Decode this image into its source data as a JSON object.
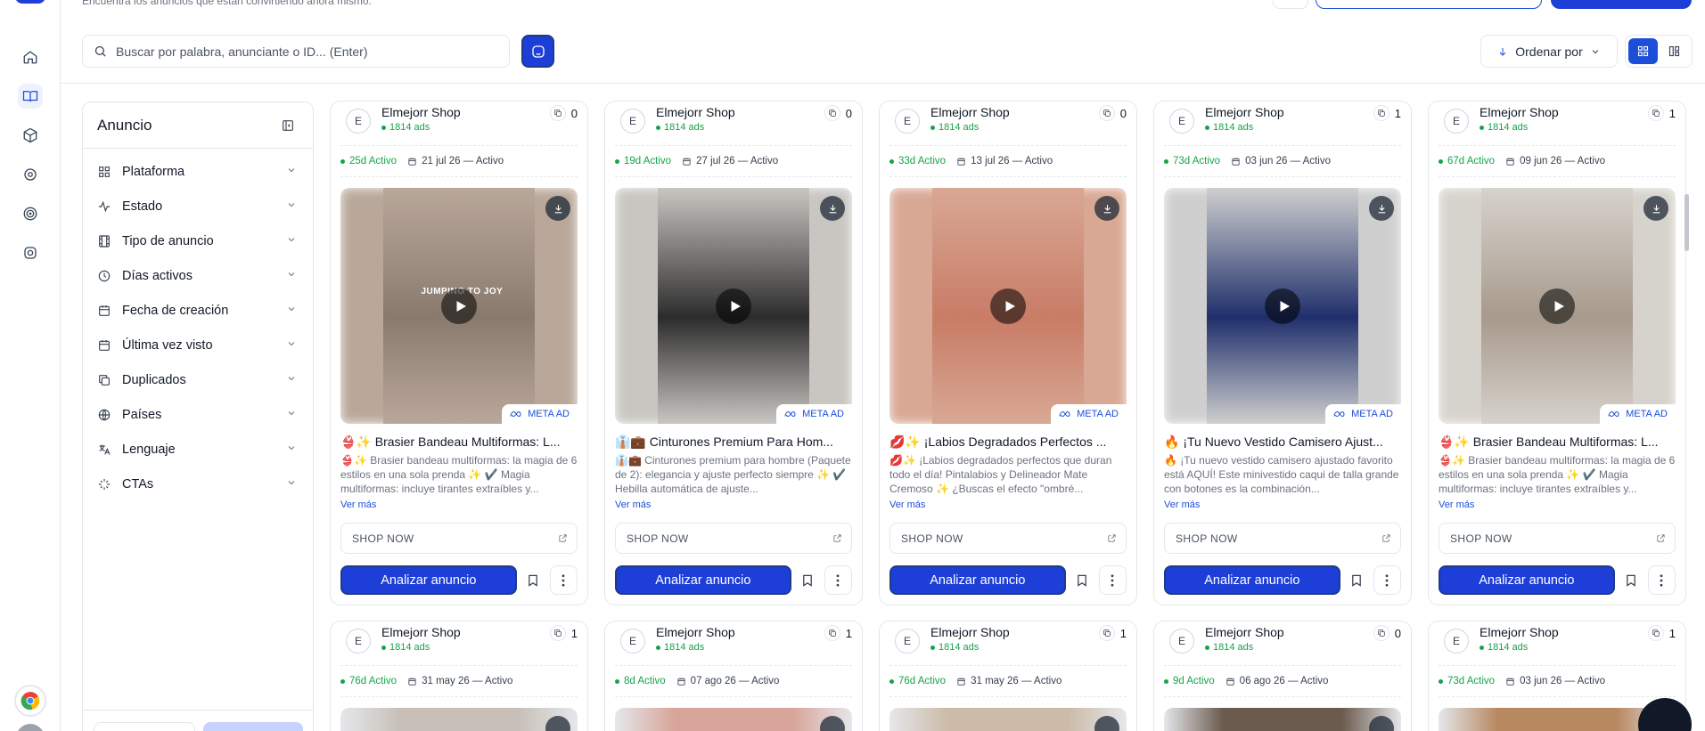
{
  "header": {
    "subtitle": "Encuentra los anuncios que están convirtiendo ahora mismo."
  },
  "search": {
    "placeholder": "Buscar por palabra, anunciante o ID... (Enter)"
  },
  "toolbar": {
    "sort_label": "Ordenar por"
  },
  "filters": {
    "title": "Anuncio",
    "items": [
      {
        "label": "Plataforma",
        "icon": "grid-icon"
      },
      {
        "label": "Estado",
        "icon": "activity-icon"
      },
      {
        "label": "Tipo de anuncio",
        "icon": "film-icon"
      },
      {
        "label": "Días activos",
        "icon": "clock-icon"
      },
      {
        "label": "Fecha de creación",
        "icon": "calendar-icon"
      },
      {
        "label": "Última vez visto",
        "icon": "calendar-icon"
      },
      {
        "label": "Duplicados",
        "icon": "copy-icon"
      },
      {
        "label": "Países",
        "icon": "globe-icon"
      },
      {
        "label": "Lenguaje",
        "icon": "language-icon"
      },
      {
        "label": "CTAs",
        "icon": "sparkle-icon"
      }
    ]
  },
  "cards": [
    {
      "advertiser": "Elmejorr Shop",
      "initial": "E",
      "ads_count": "1814 ads",
      "duplicates": "0",
      "days_active": "25d Activo",
      "date": "21 jul 26 — Activo",
      "badge": "META AD",
      "overlay": "JUMPING TO JOY",
      "title": "👙✨ Brasier Bandeau Multiformas: L...",
      "description": "👙✨ Brasier bandeau multiformas: la magia de 6 estilos en una sola prenda ✨ ✔️ Magia multiformas: incluye tirantes extraíbles y...",
      "more": "Ver más",
      "cta": "SHOP NOW",
      "analyze": "Analizar anuncio",
      "colors": {
        "bg": "#b9a89a",
        "center": "#8a7a6e"
      }
    },
    {
      "advertiser": "Elmejorr Shop",
      "initial": "E",
      "ads_count": "1814 ads",
      "duplicates": "0",
      "days_active": "19d Activo",
      "date": "27 jul 26 — Activo",
      "badge": "META AD",
      "overlay": "",
      "title": "👔💼 Cinturones Premium Para Hom...",
      "description": "👔💼 Cinturones premium para hombre (Paquete de 2): elegancia y ajuste perfecto siempre ✨ ✔️ Hebilla automática de ajuste...",
      "more": "Ver más",
      "cta": "SHOP NOW",
      "analyze": "Analizar anuncio",
      "colors": {
        "bg": "#c9c6c2",
        "center": "#2c2c2c"
      }
    },
    {
      "advertiser": "Elmejorr Shop",
      "initial": "E",
      "ads_count": "1814 ads",
      "duplicates": "0",
      "days_active": "33d Activo",
      "date": "13 jul 26 — Activo",
      "badge": "META AD",
      "overlay": "",
      "title": "💋✨ ¡Labios Degradados Perfectos ...",
      "description": "💋✨ ¡Labios degradados perfectos que duran todo el día! Pintalabios y Delineador Mate Cremoso ✨ ¿Buscas el efecto \"ombré...",
      "more": "Ver más",
      "cta": "SHOP NOW",
      "analyze": "Analizar anuncio",
      "colors": {
        "bg": "#d8a894",
        "center": "#c97c66"
      }
    },
    {
      "advertiser": "Elmejorr Shop",
      "initial": "E",
      "ads_count": "1814 ads",
      "duplicates": "1",
      "days_active": "73d Activo",
      "date": "03 jun 26 — Activo",
      "badge": "META AD",
      "overlay": "",
      "title": "🔥 ¡Tu Nuevo Vestido Camisero Ajust...",
      "description": "🔥 ¡Tu nuevo vestido camisero ajustado favorito está AQUÍ! Este minivestido caqui de talla grande con botones es la combinación...",
      "more": "Ver más",
      "cta": "SHOP NOW",
      "analyze": "Analizar anuncio",
      "colors": {
        "bg": "#cfcfcf",
        "center": "#1f2f6b"
      }
    },
    {
      "advertiser": "Elmejorr Shop",
      "initial": "E",
      "ads_count": "1814 ads",
      "duplicates": "1",
      "days_active": "67d Activo",
      "date": "09 jun 26 — Activo",
      "badge": "META AD",
      "overlay": "",
      "title": "👙✨ Brasier Bandeau Multiformas: L...",
      "description": "👙✨ Brasier bandeau multiformas: la magia de 6 estilos en una sola prenda ✨ ✔️ Magia multiformas: incluye tirantes extraíbles y...",
      "more": "Ver más",
      "cta": "SHOP NOW",
      "analyze": "Analizar anuncio",
      "colors": {
        "bg": "#d6d2cc",
        "center": "#a89a8c"
      }
    }
  ],
  "cards_row2": [
    {
      "advertiser": "Elmejorr Shop",
      "initial": "E",
      "ads_count": "1814 ads",
      "duplicates": "1",
      "days_active": "76d Activo",
      "date": "31 may 26 — Activo",
      "color": "#c8c0b8"
    },
    {
      "advertiser": "Elmejorr Shop",
      "initial": "E",
      "ads_count": "1814 ads",
      "duplicates": "1",
      "days_active": "8d Activo",
      "date": "07 ago 26 — Activo",
      "color": "#d9a59a"
    },
    {
      "advertiser": "Elmejorr Shop",
      "initial": "E",
      "ads_count": "1814 ads",
      "duplicates": "1",
      "days_active": "76d Activo",
      "date": "31 may 26 — Activo",
      "color": "#cbbba8"
    },
    {
      "advertiser": "Elmejorr Shop",
      "initial": "E",
      "ads_count": "1814 ads",
      "duplicates": "0",
      "days_active": "9d Activo",
      "date": "06 ago 26 — Activo",
      "color": "#6b5a4e"
    },
    {
      "advertiser": "Elmejorr Shop",
      "initial": "E",
      "ads_count": "1814 ads",
      "duplicates": "1",
      "days_active": "73d Activo",
      "date": "03 jun 26 — Activo",
      "color": "#b88860"
    }
  ],
  "theme": {
    "accent": "#1d3fd8",
    "active": "#16a34a",
    "link": "#1d4ed8"
  }
}
